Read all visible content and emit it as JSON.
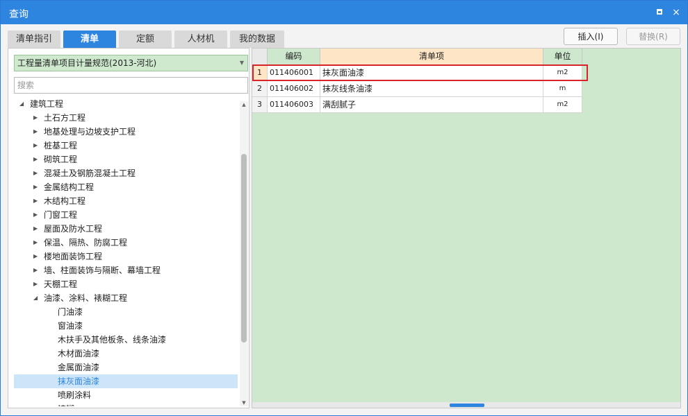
{
  "window": {
    "title": "查询",
    "maximize_icon": "maximize-icon",
    "close_icon": "close-icon",
    "close_symbol": "×"
  },
  "tabs": [
    {
      "label": "清单指引",
      "active": false
    },
    {
      "label": "清单",
      "active": true
    },
    {
      "label": "定额",
      "active": false
    },
    {
      "label": "人材机",
      "active": false
    },
    {
      "label": "我的数据",
      "active": false
    }
  ],
  "toolbar": {
    "insert_label": "插入(I)",
    "replace_label": "替换(R)",
    "replace_enabled": false
  },
  "left": {
    "dropdown_value": "工程量清单项目计量规范(2013-河北)",
    "search_placeholder": "搜索",
    "tree": [
      {
        "label": "建筑工程",
        "level": 0,
        "state": "expanded"
      },
      {
        "label": "土石方工程",
        "level": 1,
        "state": "collapsed"
      },
      {
        "label": "地基处理与边坡支护工程",
        "level": 1,
        "state": "collapsed"
      },
      {
        "label": "桩基工程",
        "level": 1,
        "state": "collapsed"
      },
      {
        "label": "砌筑工程",
        "level": 1,
        "state": "collapsed"
      },
      {
        "label": "混凝土及钢筋混凝土工程",
        "level": 1,
        "state": "collapsed"
      },
      {
        "label": "金属结构工程",
        "level": 1,
        "state": "collapsed"
      },
      {
        "label": "木结构工程",
        "level": 1,
        "state": "collapsed"
      },
      {
        "label": "门窗工程",
        "level": 1,
        "state": "collapsed"
      },
      {
        "label": "屋面及防水工程",
        "level": 1,
        "state": "collapsed"
      },
      {
        "label": "保温、隔热、防腐工程",
        "level": 1,
        "state": "collapsed"
      },
      {
        "label": "楼地面装饰工程",
        "level": 1,
        "state": "collapsed"
      },
      {
        "label": "墙、柱面装饰与隔断、幕墙工程",
        "level": 1,
        "state": "collapsed"
      },
      {
        "label": "天棚工程",
        "level": 1,
        "state": "collapsed"
      },
      {
        "label": "油漆、涂料、裱糊工程",
        "level": 1,
        "state": "expanded"
      },
      {
        "label": "门油漆",
        "level": 2,
        "state": "leaf"
      },
      {
        "label": "窗油漆",
        "level": 2,
        "state": "leaf"
      },
      {
        "label": "木扶手及其他板条、线条油漆",
        "level": 2,
        "state": "leaf"
      },
      {
        "label": "木材面油漆",
        "level": 2,
        "state": "leaf"
      },
      {
        "label": "金属面油漆",
        "level": 2,
        "state": "leaf"
      },
      {
        "label": "抹灰面油漆",
        "level": 2,
        "state": "leaf",
        "selected": true
      },
      {
        "label": "喷刷涂料",
        "level": 2,
        "state": "leaf"
      },
      {
        "label": "裱糊",
        "level": 2,
        "state": "leaf"
      }
    ]
  },
  "grid": {
    "headers": {
      "code": "编码",
      "item": "清单项",
      "unit": "单位"
    },
    "rows": [
      {
        "no": "1",
        "code": "011406001",
        "item": "抹灰面油漆",
        "unit": "m2",
        "selected": true
      },
      {
        "no": "2",
        "code": "011406002",
        "item": "抹灰线条油漆",
        "unit": "m",
        "selected": false
      },
      {
        "no": "3",
        "code": "011406003",
        "item": "满刮腻子",
        "unit": "m2",
        "selected": false
      }
    ]
  },
  "colors": {
    "accent": "#2e85e0",
    "selection_border": "#d8232a",
    "grid_background": "#cde8cd",
    "header_highlight": "#fde5c6"
  }
}
